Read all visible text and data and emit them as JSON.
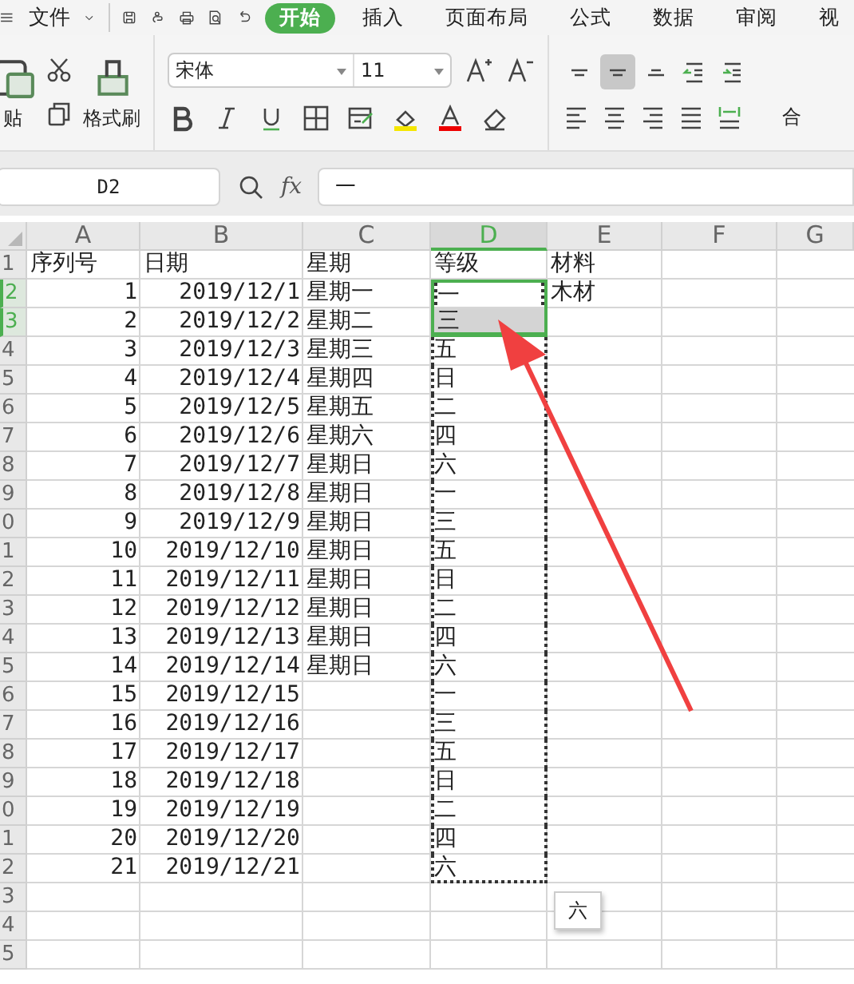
{
  "menu": {
    "file": "文件",
    "tabs": [
      {
        "label": "开始",
        "selected": true
      },
      {
        "label": "插入",
        "selected": false
      },
      {
        "label": "页面布局",
        "selected": false
      },
      {
        "label": "公式",
        "selected": false
      },
      {
        "label": "数据",
        "selected": false
      },
      {
        "label": "审阅",
        "selected": false
      },
      {
        "label": "视",
        "selected": false
      }
    ]
  },
  "clipboard": {
    "paste": "贴",
    "format_painter": "格式刷"
  },
  "font": {
    "name": "宋体",
    "size": "11"
  },
  "align_buttons": [
    {
      "kind": "top",
      "selected": false
    },
    {
      "kind": "middle",
      "selected": true
    },
    {
      "kind": "bottom",
      "selected": false
    },
    {
      "kind": "outdent",
      "selected": false
    },
    {
      "kind": "indent",
      "selected": false
    }
  ],
  "merge": "合",
  "formula_bar": {
    "cell": "D2",
    "fx_label": "fx",
    "value": "一"
  },
  "columns": [
    {
      "label": "A",
      "selected": false
    },
    {
      "label": "B",
      "selected": false
    },
    {
      "label": "C",
      "selected": false
    },
    {
      "label": "D",
      "selected": true
    },
    {
      "label": "E",
      "selected": false
    },
    {
      "label": "F",
      "selected": false
    },
    {
      "label": "G",
      "selected": false
    }
  ],
  "rows": [
    {
      "header": "1",
      "kind": "heading",
      "selected": false,
      "seq": "序列号",
      "date": "日期",
      "weekday": "星期",
      "grade": {
        "text": "等级",
        "selected": false,
        "active": false,
        "copied": false
      },
      "material": "材料"
    },
    {
      "header": "2",
      "kind": "record",
      "selected": true,
      "seq": "1",
      "date": "2019/12/1",
      "weekday": "星期一",
      "grade": {
        "text": "一",
        "selected": true,
        "active": true,
        "copied": true
      },
      "material": "木材"
    },
    {
      "header": "3",
      "kind": "record",
      "selected": true,
      "seq": "2",
      "date": "2019/12/2",
      "weekday": "星期二",
      "grade": {
        "text": "三",
        "selected": true,
        "active": false,
        "copied": true
      }
    },
    {
      "header": "4",
      "kind": "record",
      "selected": false,
      "seq": "3",
      "date": "2019/12/3",
      "weekday": "星期三",
      "grade": {
        "text": "五",
        "selected": false,
        "active": false,
        "copied": true
      }
    },
    {
      "header": "5",
      "kind": "record",
      "selected": false,
      "seq": "4",
      "date": "2019/12/4",
      "weekday": "星期四",
      "grade": {
        "text": "日",
        "selected": false,
        "active": false,
        "copied": true
      }
    },
    {
      "header": "6",
      "kind": "record",
      "selected": false,
      "seq": "5",
      "date": "2019/12/5",
      "weekday": "星期五",
      "grade": {
        "text": "二",
        "selected": false,
        "active": false,
        "copied": true
      }
    },
    {
      "header": "7",
      "kind": "record",
      "selected": false,
      "seq": "6",
      "date": "2019/12/6",
      "weekday": "星期六",
      "grade": {
        "text": "四",
        "selected": false,
        "active": false,
        "copied": true
      }
    },
    {
      "header": "8",
      "kind": "record",
      "selected": false,
      "seq": "7",
      "date": "2019/12/7",
      "weekday": "星期日",
      "grade": {
        "text": "六",
        "selected": false,
        "active": false,
        "copied": true
      }
    },
    {
      "header": "9",
      "kind": "record",
      "selected": false,
      "seq": "8",
      "date": "2019/12/8",
      "weekday": "星期日",
      "grade": {
        "text": "一",
        "selected": false,
        "active": false,
        "copied": true
      }
    },
    {
      "header": "0",
      "kind": "record",
      "selected": false,
      "seq": "9",
      "date": "2019/12/9",
      "weekday": "星期日",
      "grade": {
        "text": "三",
        "selected": false,
        "active": false,
        "copied": true
      }
    },
    {
      "header": "1",
      "kind": "record",
      "selected": false,
      "seq": "10",
      "date": "2019/12/10",
      "weekday": "星期日",
      "grade": {
        "text": "五",
        "selected": false,
        "active": false,
        "copied": true
      }
    },
    {
      "header": "2",
      "kind": "record",
      "selected": false,
      "seq": "11",
      "date": "2019/12/11",
      "weekday": "星期日",
      "grade": {
        "text": "日",
        "selected": false,
        "active": false,
        "copied": true
      }
    },
    {
      "header": "3",
      "kind": "record",
      "selected": false,
      "seq": "12",
      "date": "2019/12/12",
      "weekday": "星期日",
      "grade": {
        "text": "二",
        "selected": false,
        "active": false,
        "copied": true
      }
    },
    {
      "header": "4",
      "kind": "record",
      "selected": false,
      "seq": "13",
      "date": "2019/12/13",
      "weekday": "星期日",
      "grade": {
        "text": "四",
        "selected": false,
        "active": false,
        "copied": true
      }
    },
    {
      "header": "5",
      "kind": "record",
      "selected": false,
      "seq": "14",
      "date": "2019/12/14",
      "weekday": "星期日",
      "grade": {
        "text": "六",
        "selected": false,
        "active": false,
        "copied": true
      }
    },
    {
      "header": "6",
      "kind": "record",
      "selected": false,
      "seq": "15",
      "date": "2019/12/15",
      "grade": {
        "text": "一",
        "selected": false,
        "active": false,
        "copied": true
      }
    },
    {
      "header": "7",
      "kind": "record",
      "selected": false,
      "seq": "16",
      "date": "2019/12/16",
      "grade": {
        "text": "三",
        "selected": false,
        "active": false,
        "copied": true
      }
    },
    {
      "header": "8",
      "kind": "record",
      "selected": false,
      "seq": "17",
      "date": "2019/12/17",
      "grade": {
        "text": "五",
        "selected": false,
        "active": false,
        "copied": true
      }
    },
    {
      "header": "9",
      "kind": "record",
      "selected": false,
      "seq": "18",
      "date": "2019/12/18",
      "grade": {
        "text": "日",
        "selected": false,
        "active": false,
        "copied": true
      }
    },
    {
      "header": "0",
      "kind": "record",
      "selected": false,
      "seq": "19",
      "date": "2019/12/19",
      "grade": {
        "text": "二",
        "selected": false,
        "active": false,
        "copied": true
      }
    },
    {
      "header": "1",
      "kind": "record",
      "selected": false,
      "seq": "20",
      "date": "2019/12/20",
      "grade": {
        "text": "四",
        "selected": false,
        "active": false,
        "copied": true
      }
    },
    {
      "header": "2",
      "kind": "record",
      "selected": false,
      "seq": "21",
      "date": "2019/12/21",
      "grade": {
        "text": "六",
        "selected": false,
        "active": false,
        "copied": true
      }
    },
    {
      "header": "3",
      "kind": "record",
      "selected": false
    },
    {
      "header": "4",
      "kind": "record",
      "selected": false
    },
    {
      "header": "5",
      "kind": "record",
      "selected": false
    }
  ],
  "paste_hint": "六"
}
